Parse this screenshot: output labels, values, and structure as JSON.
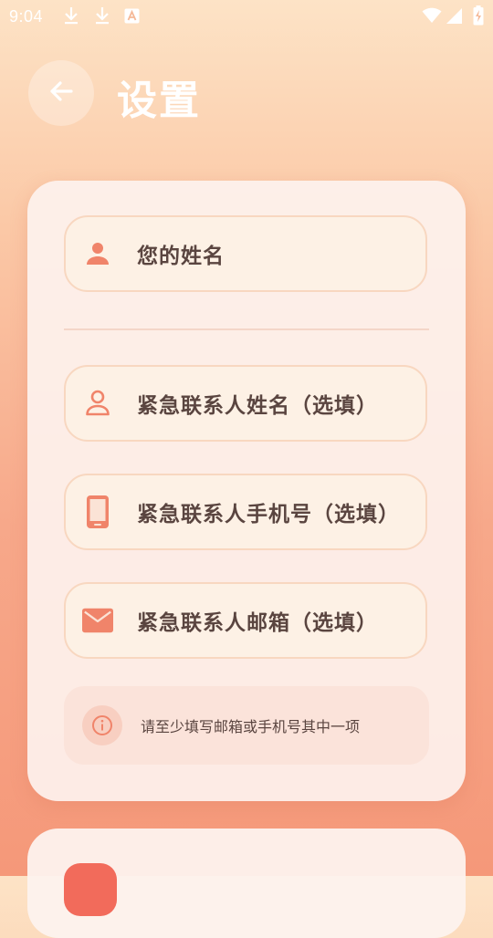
{
  "status_bar": {
    "time": "9:04",
    "icons": [
      "download-icon",
      "download-icon",
      "font-icon",
      "wifi-icon",
      "signal-icon",
      "battery-charging-icon"
    ]
  },
  "header": {
    "back_icon": "arrow-left-icon",
    "title": "设置"
  },
  "form": {
    "name_field": {
      "icon": "person-filled-icon",
      "placeholder": "您的姓名"
    },
    "emergency_name_field": {
      "icon": "person-outline-icon",
      "placeholder": "紧急联系人姓名（选填）"
    },
    "emergency_phone_field": {
      "icon": "phone-icon",
      "placeholder": "紧急联系人手机号（选填）"
    },
    "emergency_email_field": {
      "icon": "mail-icon",
      "placeholder": "紧急联系人邮箱（选填）"
    },
    "notice": {
      "icon": "info-icon",
      "text": "请至少填写邮箱或手机号其中一项"
    }
  },
  "colors": {
    "accent": "#f0846a",
    "text": "#5a4540",
    "field_bg": "#fdf1e5",
    "field_border": "#f8d7c0"
  }
}
